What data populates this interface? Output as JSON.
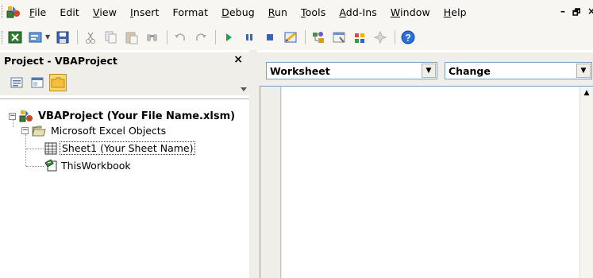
{
  "menu": {
    "items": [
      {
        "label": "File",
        "accel": "F",
        "rest": "ile"
      },
      {
        "label": "Edit",
        "accel": "",
        "rest": "Edit"
      },
      {
        "label": "View",
        "accel": "V",
        "rest": "iew"
      },
      {
        "label": "Insert",
        "accel": "I",
        "rest": "nsert"
      },
      {
        "label": "Format",
        "accel": "",
        "rest": "Format"
      },
      {
        "label": "Debug",
        "accel": "D",
        "rest": "ebug"
      },
      {
        "label": "Run",
        "accel": "R",
        "rest": "un"
      },
      {
        "label": "Tools",
        "accel": "T",
        "rest": "ools"
      },
      {
        "label": "Add-Ins",
        "accel": "A",
        "rest": "dd-Ins"
      },
      {
        "label": "Window",
        "accel": "W",
        "rest": "indow"
      },
      {
        "label": "Help",
        "accel": "H",
        "rest": "elp"
      }
    ],
    "minimize": "–",
    "restore": "🗗",
    "close": "×"
  },
  "toolbar": {
    "buttons": [
      "view-excel-icon",
      "insert-module-icon",
      "save-icon",
      "cut-icon",
      "copy-icon",
      "paste-icon",
      "find-icon",
      "undo-icon",
      "redo-icon",
      "run-icon",
      "break-icon",
      "reset-icon",
      "design-mode-icon",
      "project-explorer-icon",
      "properties-icon",
      "object-browser-icon",
      "toolbox-icon",
      "help-icon"
    ]
  },
  "project_panel": {
    "title": "Project - VBAProject",
    "close": "×",
    "tree": {
      "root": "VBAProject (Your File Name.xlsm)",
      "folder": "Microsoft Excel Objects",
      "sheet": "Sheet1 (Your Sheet Name)",
      "workbook": "ThisWorkbook"
    }
  },
  "code_window": {
    "object_combo": "Worksheet",
    "procedure_combo": "Change"
  },
  "colors": {
    "chrome": "#f0eee8",
    "combo_border": "#7f9db9",
    "folder_active": "#f7d66c"
  }
}
